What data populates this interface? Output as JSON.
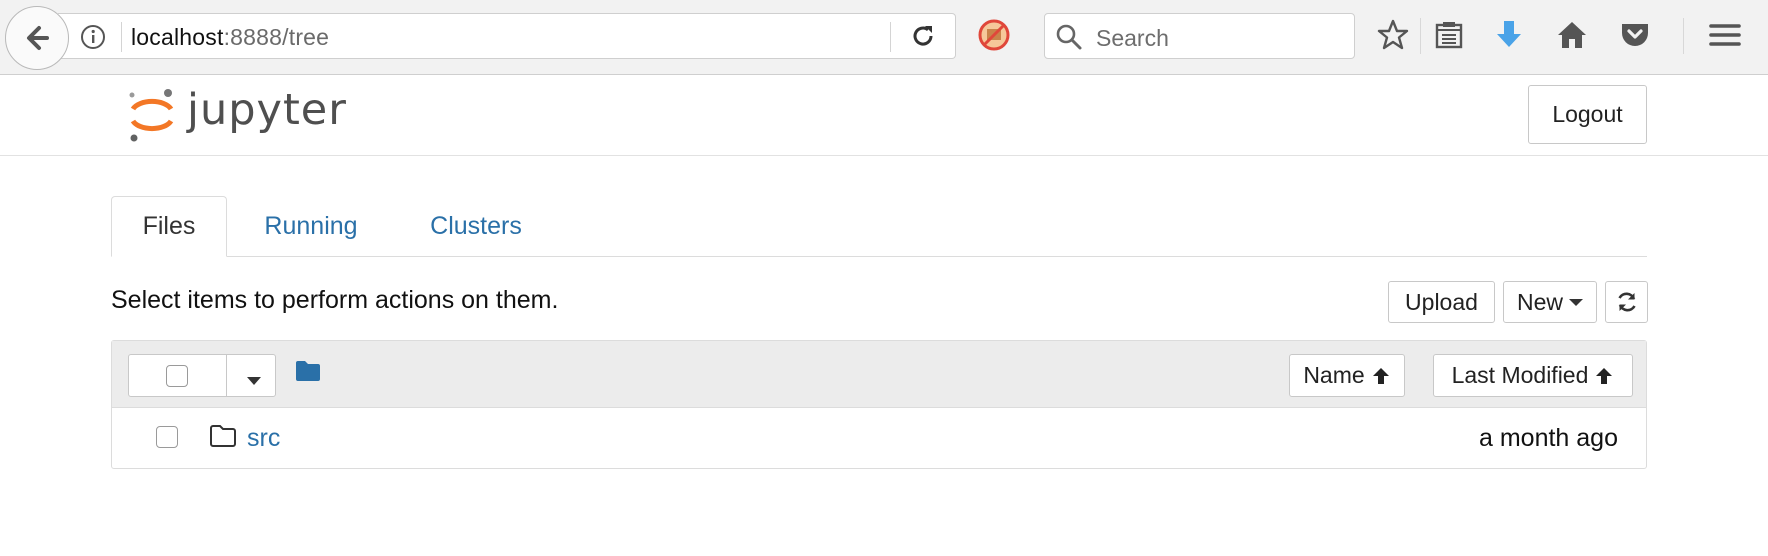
{
  "browser": {
    "url_host": "localhost",
    "url_rest": ":8888/tree",
    "search_placeholder": "Search"
  },
  "header": {
    "wordmark": "jupyter",
    "logout_label": "Logout"
  },
  "tabs": [
    {
      "label": "Files",
      "active": true
    },
    {
      "label": "Running",
      "active": false
    },
    {
      "label": "Clusters",
      "active": false
    }
  ],
  "toolbar": {
    "hint": "Select items to perform actions on them.",
    "upload_label": "Upload",
    "new_label": "New"
  },
  "list": {
    "sort_name_label": "Name",
    "sort_modified_label": "Last Modified",
    "rows": [
      {
        "name": "src",
        "type": "folder",
        "modified": "a month ago"
      }
    ]
  },
  "colors": {
    "link": "#2a70a8",
    "jupyter_orange": "#f37726",
    "download_blue": "#4aa3e8"
  }
}
